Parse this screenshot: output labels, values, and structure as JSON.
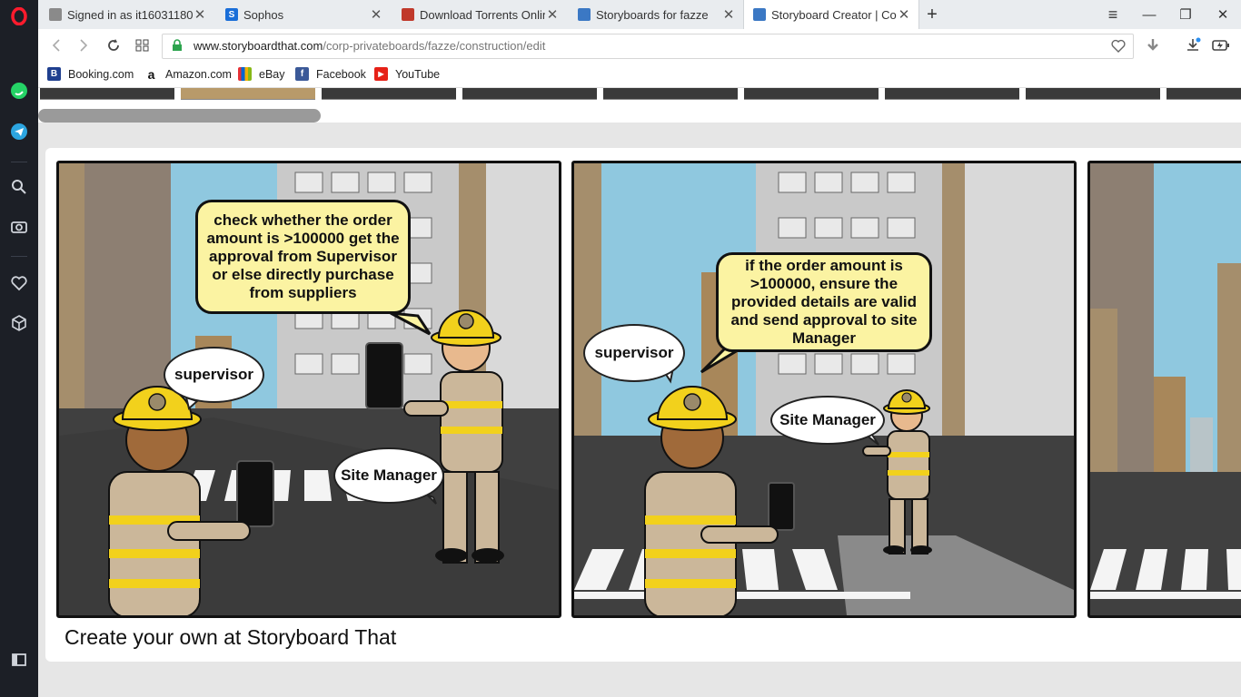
{
  "tabs": [
    {
      "label": "Signed in as it16031180",
      "favicon_color": "#7a7a7a"
    },
    {
      "label": "Sophos",
      "favicon_color": "#1a6ed8"
    },
    {
      "label": "Download Torrents Online",
      "favicon_color": "#c0392b"
    },
    {
      "label": "Storyboards for fazze",
      "favicon_color": "#3b78c4"
    },
    {
      "label": "Storyboard Creator | Comi",
      "favicon_color": "#3b78c4"
    }
  ],
  "window": {
    "new_tab": "+",
    "menu": "≡",
    "minimize": "—",
    "restore": "❐",
    "close": "✕"
  },
  "address": {
    "host": "www.storyboardthat.com",
    "path": "/corp-privateboards/fazze/construction/edit"
  },
  "bookmarks": [
    {
      "label": "Booking.com",
      "icon": "B",
      "color": "#1f3f8f"
    },
    {
      "label": "Amazon.com",
      "icon": "a",
      "color": "#ffffff"
    },
    {
      "label": "eBay",
      "icon": "e",
      "color": "#e53238"
    },
    {
      "label": "Facebook",
      "icon": "f",
      "color": "#3b5998"
    },
    {
      "label": "YouTube",
      "icon": "▶",
      "color": "#e62117"
    }
  ],
  "storyboard": {
    "panel1": {
      "speech": "check whether the order amount is >100000 get the approval from Supervisor or else directly purchase from suppliers",
      "label_supervisor": "supervisor",
      "label_site_manager": "Site Manager"
    },
    "panel2": {
      "speech": "if the order amount is >100000, ensure the provided details are valid and send approval to site Manager",
      "label_supervisor": "supervisor",
      "label_site_manager": "Site Manager"
    },
    "footer": "Create your own at Storyboard That"
  },
  "colors": {
    "sidebar": "#1c1f26",
    "bubble_fill": "#fbf3a2",
    "sky": "#8fc8df",
    "helmet": "#f2d11c",
    "uniform": "#cbb79a",
    "stripe": "#f2d11c"
  }
}
